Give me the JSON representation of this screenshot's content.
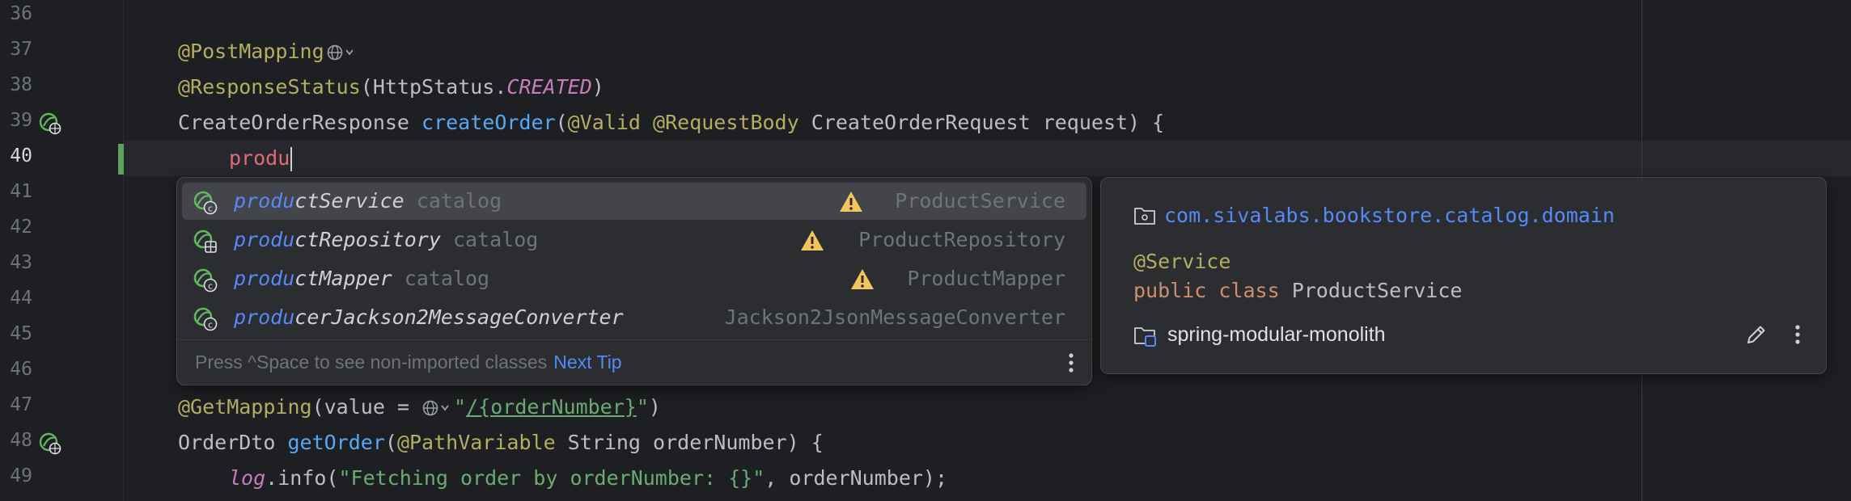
{
  "gutter": {
    "line_numbers": [
      "36",
      "37",
      "38",
      "39",
      "40",
      "41",
      "42",
      "43",
      "44",
      "45",
      "46",
      "47",
      "48",
      "49"
    ]
  },
  "code": {
    "l37": {
      "ann": "@PostMapping"
    },
    "l38": {
      "ann": "@ResponseStatus",
      "p1": "(HttpStatus.",
      "const": "CREATED",
      "p2": ")"
    },
    "l39": {
      "t1": "CreateOrderResponse ",
      "fn": "createOrder",
      "t2": "(",
      "a1": "@Valid",
      "t3": " ",
      "a2": "@RequestBody",
      "t4": " CreateOrderRequest request) {"
    },
    "l40": {
      "typed": "produ"
    },
    "l47": {
      "ann": "@GetMapping",
      "t1": "(value = ",
      "str_open": "\"",
      "str_link": "/{orderNumber}",
      "str_close": "\"",
      "t2": ")"
    },
    "l48": {
      "t1": "OrderDto ",
      "fn": "getOrder",
      "t2": "(",
      "ann": "@PathVariable",
      "t3": " String orderNumber) {"
    },
    "l49": {
      "log": "log",
      "t1": ".info(",
      "str": "\"Fetching order by orderNumber: {}\"",
      "t2": ", orderNumber);"
    }
  },
  "completion": {
    "items": [
      {
        "match": "produ",
        "rest": "ctService",
        "pkg": "catalog",
        "type": "ProductService",
        "warning": true,
        "icon": "spring-bean-class-icon"
      },
      {
        "match": "produ",
        "rest": "ctRepository",
        "pkg": "catalog",
        "type": "ProductRepository",
        "warning": true,
        "icon": "spring-bean-repository-icon"
      },
      {
        "match": "produ",
        "rest": "ctMapper",
        "pkg": "catalog",
        "type": "ProductMapper",
        "warning": true,
        "icon": "spring-bean-class-icon"
      },
      {
        "match": "produ",
        "rest": "cerJackson2MessageConverter",
        "pkg": "",
        "type": "Jackson2JsonMessageConverter",
        "warning": false,
        "icon": "spring-bean-class-icon"
      }
    ],
    "footer_hint": "Press ^Space to see non-imported classes",
    "next_tip": "Next Tip"
  },
  "doc": {
    "package": "com.sivalabs.bookstore.catalog.domain",
    "annotation": "@Service",
    "kw_public": "public",
    "kw_class": "class",
    "class_name": "ProductService",
    "module": "spring-modular-monolith"
  },
  "colors": {
    "background": "#1e1f22",
    "popup": "#2b2d30",
    "match_highlight": "#548af7",
    "annotation": "#b3ae60",
    "keyword": "#cf8e6d",
    "string": "#6aab73",
    "warning": "#f2c55c"
  }
}
